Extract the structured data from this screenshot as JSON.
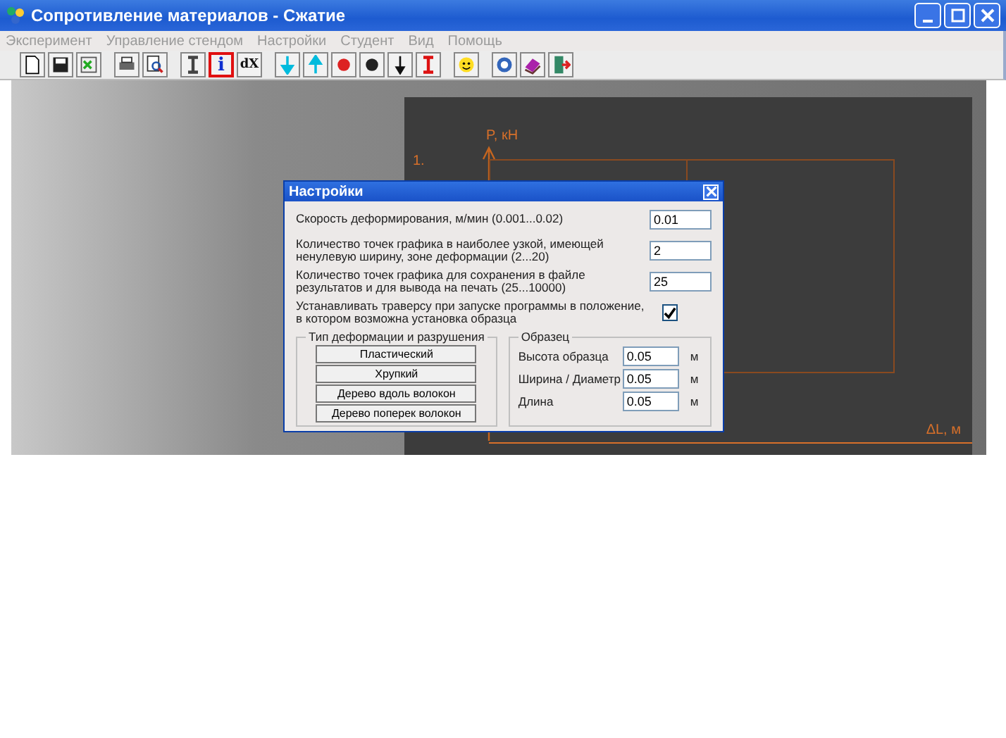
{
  "window": {
    "title": "Сопротивление материалов - Сжатие"
  },
  "menu": [
    "Эксперимент",
    "Управление стендом",
    "Настройки",
    "Студент",
    "Вид",
    "Помощь"
  ],
  "toolbar": [
    {
      "kind": "new",
      "selected": false
    },
    {
      "kind": "save",
      "selected": false
    },
    {
      "kind": "export",
      "selected": false
    },
    {
      "kind": "sep"
    },
    {
      "kind": "print",
      "selected": false
    },
    {
      "kind": "preview",
      "selected": false
    },
    {
      "kind": "sep"
    },
    {
      "kind": "beam",
      "selected": false
    },
    {
      "kind": "info",
      "label": "i",
      "selected": true
    },
    {
      "kind": "dx",
      "label": "dX",
      "selected": false
    },
    {
      "kind": "sep"
    },
    {
      "kind": "down-cyan",
      "selected": false
    },
    {
      "kind": "up-cyan",
      "selected": false
    },
    {
      "kind": "ball-red",
      "selected": false
    },
    {
      "kind": "ball-black",
      "selected": false
    },
    {
      "kind": "down-black",
      "selected": false
    },
    {
      "kind": "beam-red",
      "selected": false
    },
    {
      "kind": "sep"
    },
    {
      "kind": "smiley",
      "selected": false
    },
    {
      "kind": "sep"
    },
    {
      "kind": "help",
      "selected": false
    },
    {
      "kind": "books",
      "selected": false
    },
    {
      "kind": "exit",
      "selected": false
    }
  ],
  "chart": {
    "y_label": "P, кН",
    "x_label": "ΔL, м",
    "curve_label": "1."
  },
  "dialog": {
    "title": "Настройки",
    "fields": [
      {
        "label": "Скорость деформирования, м/мин (0.001...0.02)",
        "value": "0.01"
      },
      {
        "label": "Количество точек графика в наиболее узкой, имеющей ненулевую ширину, зоне деформации (2...20)",
        "value": "2"
      },
      {
        "label": "Количество точек графика для сохранения в файле результатов и для вывода на печать (25...10000)",
        "value": "25"
      }
    ],
    "checkbox": {
      "label": "Устанавливать траверсу при запуске программы в положение, в котором возможна установка образца",
      "checked": true
    },
    "deformation_group": {
      "title": "Тип деформации и разрушения",
      "buttons": [
        "Пластический",
        "Хрупкий",
        "Дерево вдоль волокон",
        "Дерево поперек волокон"
      ]
    },
    "specimen_group": {
      "title": "Образец",
      "rows": [
        {
          "label": "Высота образца",
          "value": "0.05",
          "unit": "м"
        },
        {
          "label": "Ширина / Диаметр",
          "value": "0.05",
          "unit": "м"
        },
        {
          "label": "Длина",
          "value": "0.05",
          "unit": "м"
        }
      ]
    }
  }
}
